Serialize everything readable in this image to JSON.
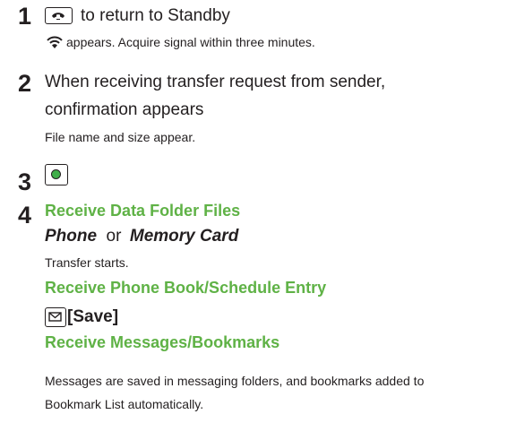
{
  "steps": [
    {
      "number": "1",
      "text": "to return to Standby",
      "key_icon": "end-call-key-icon",
      "note_icon": "wireless-signal-icon",
      "note": "appears. Acquire signal within three minutes."
    },
    {
      "number": "2",
      "text_line1": "When receiving transfer request from sender,",
      "text_line2": "confirmation appears",
      "note": "File name and size appear."
    },
    {
      "number": "3",
      "key_icon": "center-select-key-icon"
    },
    {
      "number": "4",
      "sections": [
        {
          "heading": "Receive Data Folder Files",
          "option_a": "Phone",
          "option_joiner": "or",
          "option_b": "Memory Card",
          "note": "Transfer starts."
        },
        {
          "heading": "Receive Phone Book/Schedule Entry",
          "key_icon": "mail-key-icon",
          "action_label": "[Save]"
        },
        {
          "heading": "Receive Messages/Bookmarks",
          "note_line1": "Messages are saved in messaging folders, and bookmarks added to",
          "note_line2": "Bookmark List automatically."
        }
      ]
    }
  ],
  "colors": {
    "text": "#231f20",
    "heading_green": "#5fb246",
    "select_key_green": "#3fae49"
  }
}
